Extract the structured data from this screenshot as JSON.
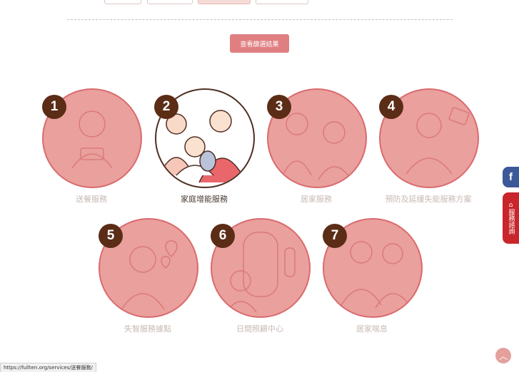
{
  "filter": {
    "result_button": "查看篩選結果"
  },
  "services": [
    {
      "num": "1",
      "label": "送餐服務",
      "active": false
    },
    {
      "num": "2",
      "label": "家庭增能服務",
      "active": true
    },
    {
      "num": "3",
      "label": "居家服務",
      "active": false
    },
    {
      "num": "4",
      "label": "預防及延緩失能服務方案",
      "active": false
    },
    {
      "num": "5",
      "label": "失智服務據點",
      "active": false
    },
    {
      "num": "6",
      "label": "日間照顧中心",
      "active": false
    },
    {
      "num": "7",
      "label": "居家喘息",
      "active": false
    }
  ],
  "side": {
    "facebook": "f",
    "consult": "服務諮詢"
  },
  "status_url": "https://fullten.org/services/送餐服務/",
  "colors": {
    "accent": "#e07f82",
    "circle": "#eaa09d",
    "number_badge": "#5b2c16",
    "facebook": "#3b5998",
    "consult": "#c8262a"
  }
}
